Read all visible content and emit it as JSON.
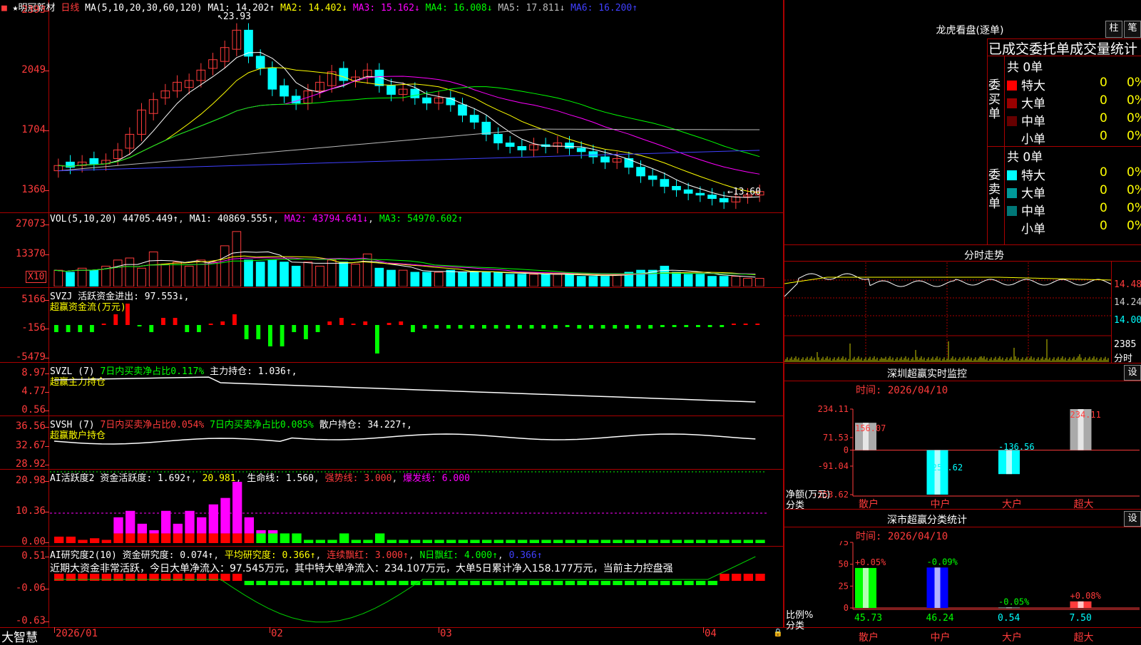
{
  "stock": {
    "name_prefix": "★明冠新材",
    "period": "日线"
  },
  "main_chart": {
    "ma_label": "MA(5,10,20,30,60,120)",
    "ma_values": [
      {
        "name": "MA1",
        "value": "14.202↑",
        "color": "#ffffff"
      },
      {
        "name": "MA2",
        "value": "14.402↓",
        "color": "#ffff00"
      },
      {
        "name": "MA3",
        "value": "15.162↓",
        "color": "#ff00ff"
      },
      {
        "name": "MA4",
        "value": "16.008↓",
        "color": "#00ff00"
      },
      {
        "name": "MA5",
        "value": "17.811↓",
        "color": "#bbbbbb"
      },
      {
        "name": "MA6",
        "value": "16.200↑",
        "color": "#4040ff"
      }
    ],
    "y_ticks": [
      "2393",
      "2049",
      "1704",
      "1360"
    ],
    "high_mark": "23.93",
    "low_mark": "13.60"
  },
  "vol_chart": {
    "label": "VOL(5,10,20)",
    "vol": "44705.449↑",
    "ma1": "MA1: 40869.555↑",
    "ma2": "MA2: 43794.641↓",
    "ma3": "MA3: 54970.602↑",
    "y_ticks": [
      "27073",
      "13370"
    ],
    "unit": "X10"
  },
  "svzj": {
    "label": "SVZJ",
    "line": "活跃资金进出: 97.553↓,",
    "sub": "超赢资金流(万元)",
    "y_ticks": [
      "5166",
      "-156",
      "-5479"
    ]
  },
  "svzl": {
    "label": "SVZL (7)",
    "ratio": "7日内买卖净占比0.117%",
    "hold": "主力持仓: 1.036↑,",
    "sub": "超赢主力持仓",
    "y_ticks": [
      "8.97",
      "4.77",
      "0.56"
    ]
  },
  "svsh": {
    "label": "SVSH (7)",
    "ratio1": "7日内买卖净占比0.054%",
    "ratio2": "7日内买卖净占比0.085%",
    "hold": "散户持仓: 34.227↑,",
    "sub": "超赢散户持仓",
    "y_ticks": [
      "36.56",
      "32.67",
      "28.92"
    ]
  },
  "ai1": {
    "label": "AI活跃度2",
    "a": "资金活跃度: 1.692↑",
    "b": "20.981",
    "c": "生命线: 1.560",
    "d": "强势线: 3.000",
    "e": "爆发线: 6.000",
    "y_ticks": [
      "20.98",
      "10.36",
      "0.00"
    ]
  },
  "ai2": {
    "label": "AI研究度2(10)",
    "a": "资金研究度: 0.074↑",
    "b": "平均研究度: 0.366↑",
    "c": "连续飘红: 3.000↑",
    "d": "N日飘红: 4.000↑",
    "e": "0.366↑",
    "comment": "近期大资金非常活跃，今日大单净流入：97.545万元，其中特大单净流入：234.107万元，大单5日累计净入158.177万元，当前主力控盘强",
    "y_ticks": [
      "0.51",
      "-0.06",
      "-0.63"
    ]
  },
  "x_axis": {
    "labels": [
      "2026/01",
      "02",
      "03",
      "04"
    ],
    "brand": "大智慧"
  },
  "lhb": {
    "title": "龙虎看盘(逐单)",
    "btn1": "柱",
    "btn2": "笔",
    "heading": "已成交委托单成交量统计",
    "buy_side": "委买单",
    "sell_side": "委卖单",
    "buy_total": "共 0单",
    "sell_total": "共 0单",
    "buy_rows": [
      {
        "label": "特大",
        "count": "0",
        "pct": "0%",
        "color": "#ff0000"
      },
      {
        "label": "大单",
        "count": "0",
        "pct": "0%",
        "color": "#990000"
      },
      {
        "label": "中单",
        "count": "0",
        "pct": "0%",
        "color": "#660000"
      },
      {
        "label": "小单",
        "count": "0",
        "pct": "0%",
        "color": ""
      }
    ],
    "sell_rows": [
      {
        "label": "特大",
        "count": "0",
        "pct": "0%",
        "color": "#00ffff"
      },
      {
        "label": "大单",
        "count": "0",
        "pct": "0%",
        "color": "#009999"
      },
      {
        "label": "中单",
        "count": "0",
        "pct": "0%",
        "color": "#007777"
      },
      {
        "label": "小单",
        "count": "0",
        "pct": "0%",
        "color": ""
      }
    ]
  },
  "intraday": {
    "title": "分时走势",
    "price_ticks": [
      "14.48",
      "14.24",
      "14.00"
    ],
    "vol_tick": "2385",
    "vol_unit": "分时"
  },
  "sz_monitor": {
    "title": "深圳超赢实时监控",
    "btn": "设",
    "time": "时间: 2026/04/10",
    "y_ticks": [
      "234.11",
      "71.53",
      "0",
      "-91.04",
      "-253.62"
    ],
    "ylabel": "净额(万元)",
    "xlabel": "分类",
    "chart_data": {
      "type": "bar",
      "categories": [
        "散户",
        "中户",
        "大户",
        "超大"
      ],
      "values": [
        156.07,
        -253.62,
        -136.56,
        234.11
      ],
      "ylim": [
        -253.62,
        234.11
      ]
    }
  },
  "sz_class": {
    "title": "深市超赢分类统计",
    "btn": "设",
    "time": "时间: 2026/04/10",
    "y_ticks": [
      "75",
      "50",
      "25",
      "0"
    ],
    "ylabel": "比例%",
    "xlabel": "分类",
    "chart_data": {
      "type": "bar",
      "categories": [
        "散户",
        "中户",
        "大户",
        "超大"
      ],
      "values": [
        45.73,
        46.24,
        0.54,
        7.5
      ],
      "changes": [
        "+0.05%",
        "-0.09%",
        "-0.05%",
        "+0.08%"
      ],
      "ylim": [
        0,
        75
      ]
    }
  }
}
